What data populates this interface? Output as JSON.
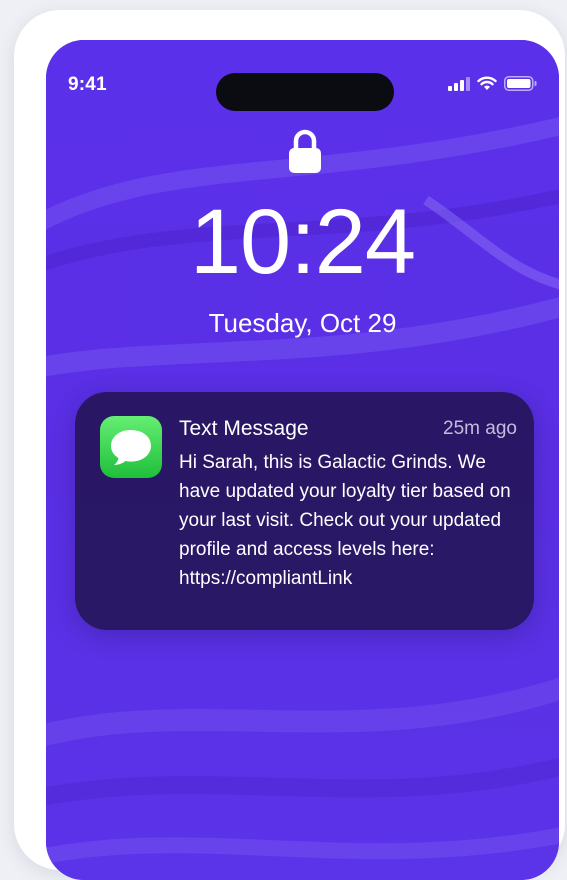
{
  "status_bar": {
    "time": "9:41",
    "icons": [
      "cellular-signal-icon",
      "wifi-icon",
      "battery-icon"
    ]
  },
  "lock_screen": {
    "lock_icon": "lock-icon",
    "time": "10:24",
    "date": "Tuesday, Oct 29"
  },
  "notification": {
    "app_icon": "messages-app-icon",
    "title": "Text Message",
    "time_ago": "25m ago",
    "body": "Hi Sarah, this is Galactic Grinds. We have updated your loyalty tier based on your last visit. Check out your updated profile and access levels here: https://compliantLink"
  },
  "colors": {
    "wallpaper": "#5a2fe6",
    "notification_bg": "#221454",
    "messages_green": "#34c759"
  }
}
